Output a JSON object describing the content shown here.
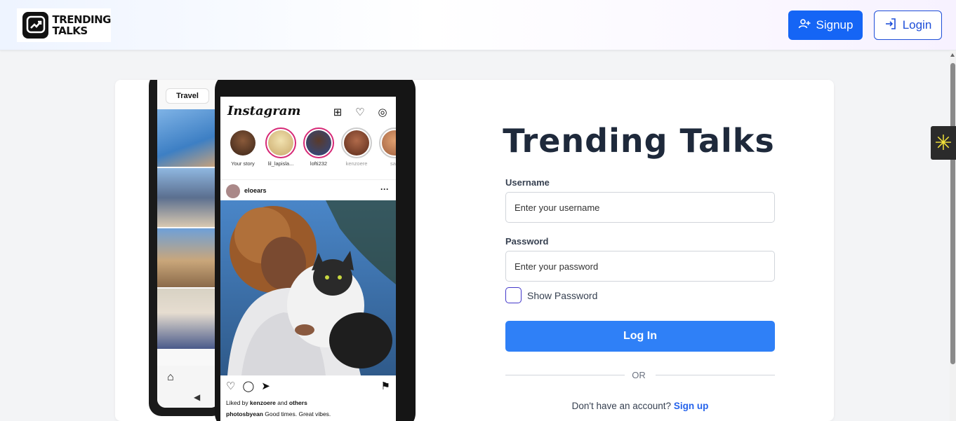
{
  "header": {
    "logo_text_line1": "TRENDING",
    "logo_text_line2": "TALKS",
    "signup_label": "Signup",
    "login_label": "Login"
  },
  "illustration": {
    "travel_tag": "Travel",
    "app_name": "Instagram",
    "stories": [
      {
        "name": "Your story"
      },
      {
        "name": "lil_lapisla..."
      },
      {
        "name": "lofti232"
      },
      {
        "name": "kenzoere"
      },
      {
        "name": "sap"
      }
    ],
    "post_user": "eloears",
    "likes_prefix": "Liked by",
    "likes_user": "kenzoere",
    "likes_and": "and",
    "likes_others": "others",
    "caption_user": "photosbyean",
    "caption_text": "Good times. Great vibes."
  },
  "form": {
    "title": "Trending Talks",
    "username_label": "Username",
    "username_placeholder": "Enter your username",
    "username_value": "",
    "password_label": "Password",
    "password_placeholder": "Enter your password",
    "password_value": "",
    "show_password_label": "Show Password",
    "show_password_checked": false,
    "submit_label": "Log In",
    "divider_text": "OR",
    "no_account_text": "Don't have an account?",
    "signup_link": "Sign up"
  },
  "colors": {
    "primary": "#1565f5",
    "submit": "#2f80f7",
    "link": "#2563eb",
    "title": "#1e293b"
  },
  "icons": {
    "signup": "user-plus-icon",
    "login": "login-arrow-icon",
    "logo": "trending-chart-icon",
    "side_widget": "sparkle-icon"
  }
}
